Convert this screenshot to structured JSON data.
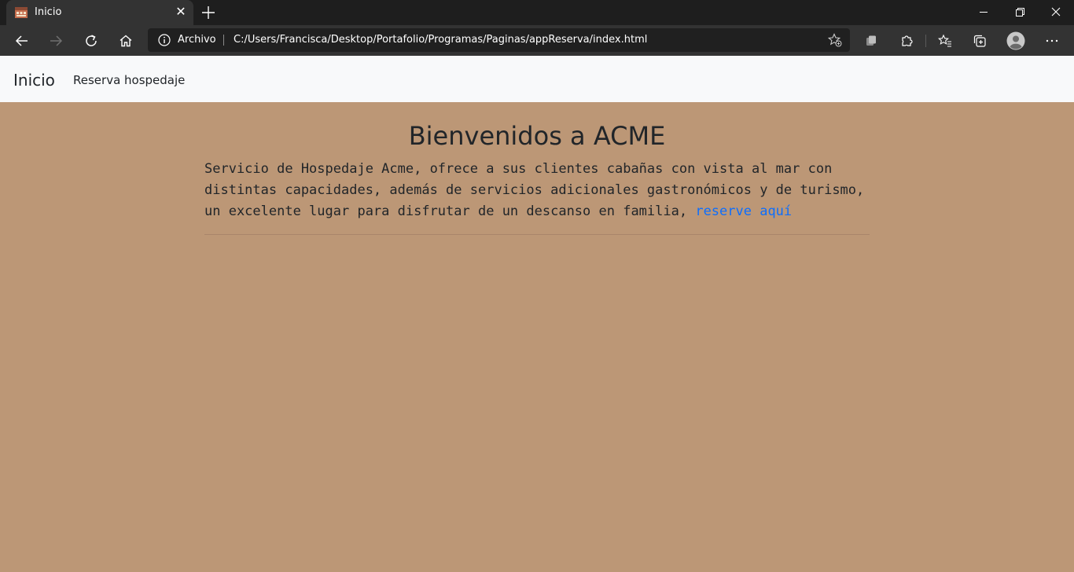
{
  "browser": {
    "tab": {
      "title": "Inicio",
      "close_glyph": "✕",
      "favicon": "acme-favicon-icon"
    },
    "new_tab_icon": "plus-icon",
    "window_controls": [
      "minimize-icon",
      "restore-icon",
      "close-icon"
    ],
    "toolbar": {
      "back_icon": "arrow-left-icon",
      "forward_icon": "arrow-right-icon",
      "refresh_icon": "refresh-icon",
      "home_icon": "home-icon"
    },
    "address": {
      "scheme_label": "Archivo",
      "url": "C:/Users/Francisca/Desktop/Portafolio/Programas/Paginas/appReserva/index.html"
    },
    "right_icons": [
      "add-favorite-icon",
      "copilot-icon",
      "extensions-icon",
      "favorites-icon",
      "collections-icon",
      "profile-avatar-icon",
      "more-icon"
    ]
  },
  "page": {
    "navbar": {
      "brand": "Inicio",
      "link": "Reserva hospedaje"
    },
    "title": "Bienvenidos a ACME",
    "intro_text": "Servicio de Hospedaje Acme, ofrece a sus clientes cabañas con vista al mar con distintas capacidades, además de servicios adicionales gastronómicos y de turismo, un excelente lugar para disfrutar de un descanso en familia, ",
    "intro_link": "reserve aquí"
  },
  "colors": {
    "page_background": "#bc9776",
    "navbar_background": "#f8f9fa",
    "link": "#0d6efd",
    "browser_chrome": "#333333",
    "tab_strip": "#1e1e1e"
  }
}
